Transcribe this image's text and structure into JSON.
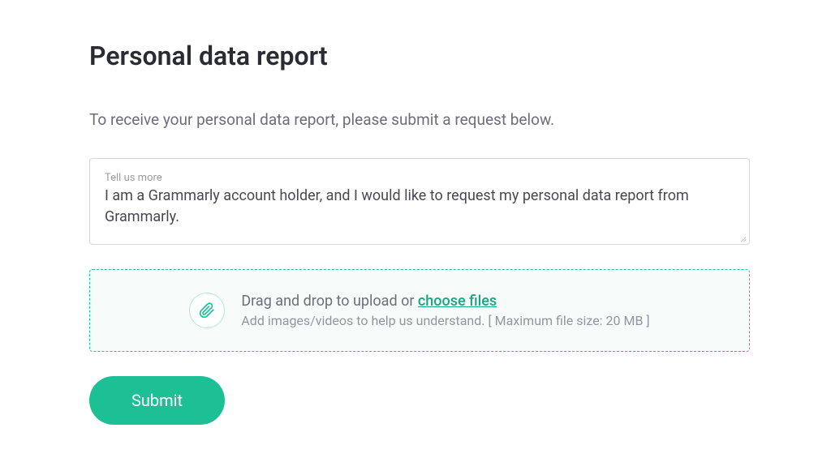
{
  "title": "Personal data report",
  "description": "To receive your personal data report, please submit a request below.",
  "textarea": {
    "label": "Tell us more",
    "value": "I am a Grammarly account holder, and I would like to request my personal data report from Grammarly."
  },
  "upload": {
    "prefix": "Drag and drop to upload or ",
    "link": "choose files",
    "subtext": "Add images/videos to help us understand. [ Maximum file size: 20 MB ]"
  },
  "submit": "Submit"
}
